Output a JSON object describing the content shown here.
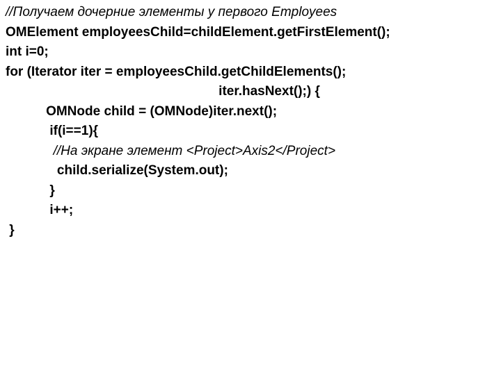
{
  "code": {
    "l1": "//Получаем дочерние элементы у первого Employees",
    "l2": "OMElement employeesChild=childElement.getFirstElement();",
    "l3": "int i=0;",
    "l4": "for (Iterator iter = employeesChild.getChildElements();",
    "l5": "                                                          iter.hasNext();) {",
    "l6": "",
    "l7": "           OMNode child = (OMNode)iter.next();",
    "l8": "            if(i==1){",
    "l9_a": "             ",
    "l9_b": "//На экране элемент <Project>Axis2</Project>",
    "l10": "              child.serialize(System.out);",
    "l11": "            }",
    "l12": "            i++;",
    "l13": " }"
  }
}
